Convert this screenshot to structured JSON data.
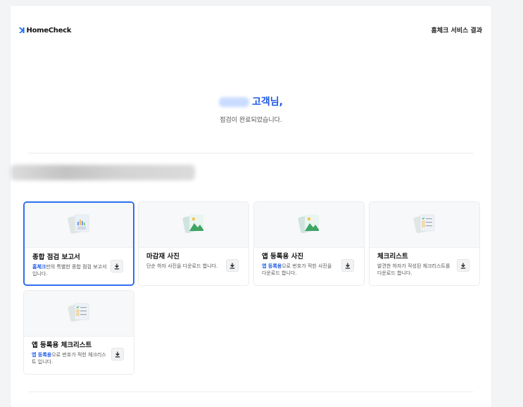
{
  "header": {
    "logo_mark": "ꓘ",
    "logo_text": "HomeCheck",
    "title": "홈체크 서비스 결과"
  },
  "greeting": {
    "title_suffix": "고객님,",
    "subtitle": "점검이 완료되었습니다."
  },
  "cards": [
    {
      "title": "종합 점검 보고서",
      "desc_accent": "홈체크",
      "desc_rest": "만의 특별한 종합 점검 보고서입니다.",
      "icon": "report-chart-icon",
      "selected": true
    },
    {
      "title": "마감재 사진",
      "desc_accent": "",
      "desc_rest": "단순 하자 사진을 다운로드 합니다.",
      "icon": "photo-icon",
      "selected": false
    },
    {
      "title": "앱 등록용 사진",
      "desc_accent": "앱 등록용",
      "desc_rest": "으로 번호가 적힌 사진을 다운로드 합니다.",
      "icon": "photo-icon",
      "selected": false
    },
    {
      "title": "체크리스트",
      "desc_accent": "",
      "desc_rest": "발견한 하자가 작성된 체크리스트를 다운로드 합니다.",
      "icon": "checklist-icon",
      "selected": false
    },
    {
      "title": "앱 등록용 체크리스트",
      "desc_accent": "앱 등록용",
      "desc_rest": "으로 번호가 적힌 체크리스트 입니다.",
      "icon": "checklist-icon",
      "selected": false
    }
  ],
  "colors": {
    "accent": "#1f5be7",
    "selected_border": "#2f6ff0"
  }
}
